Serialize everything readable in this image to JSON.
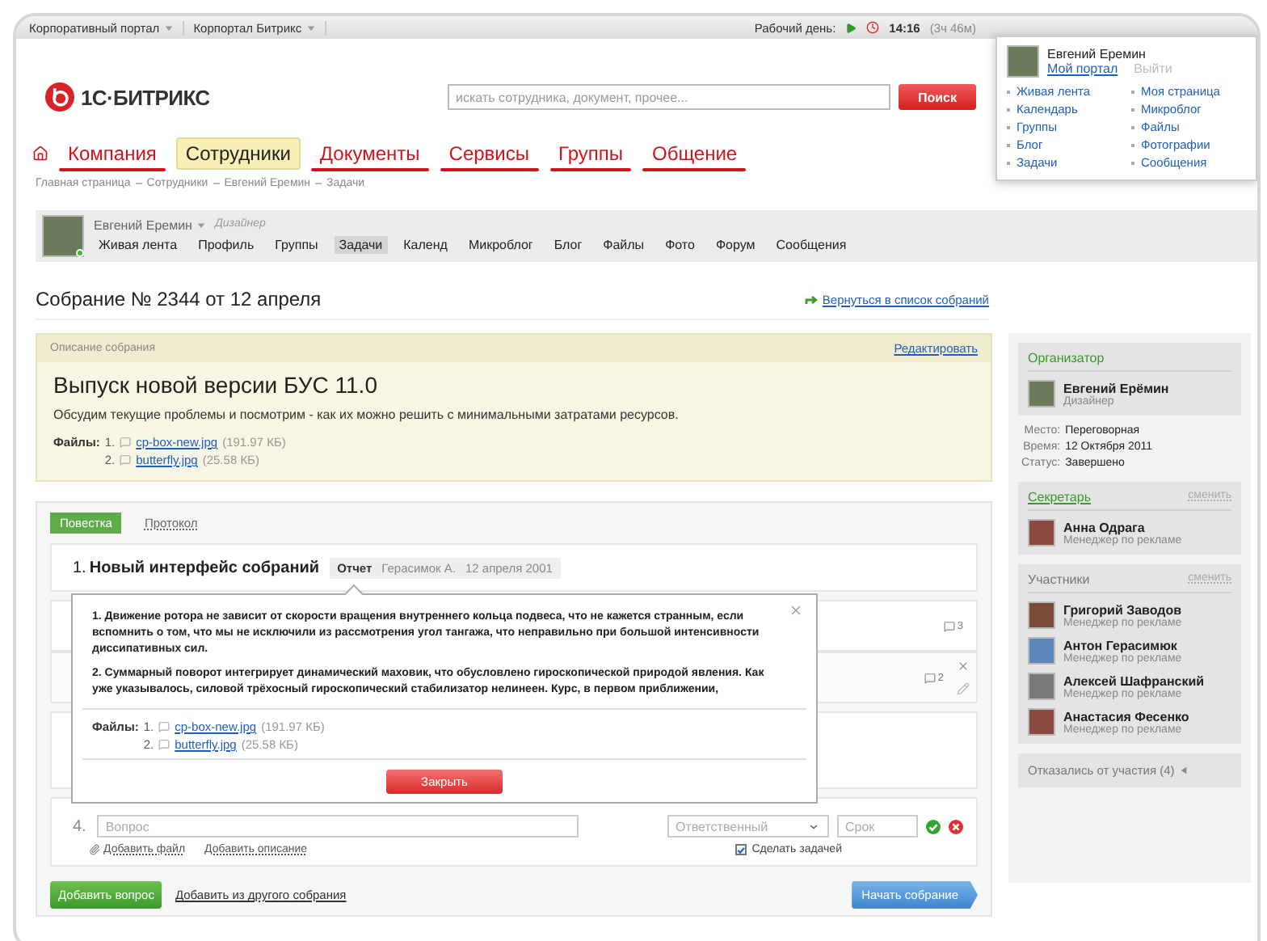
{
  "top_bar": {
    "left_items": [
      "Корпоративный портал",
      "Корпортал Битрикс"
    ],
    "workday_label": "Рабочий день:",
    "time": "14:16",
    "duration": "(3ч 46м)"
  },
  "header": {
    "logo": "1С·БИТРИКС",
    "search": {
      "placeholder": "искать сотрудника, документ, прочее..."
    },
    "search_button": "Поиск"
  },
  "main_nav": [
    {
      "label": "Компания",
      "selected": false
    },
    {
      "label": "Сотрудники",
      "selected": true
    },
    {
      "label": "Документы",
      "selected": false
    },
    {
      "label": "Сервисы",
      "selected": false
    },
    {
      "label": "Группы",
      "selected": false
    },
    {
      "label": "Общение",
      "selected": false
    }
  ],
  "breadcrumbs": [
    "Главная страница",
    "Сотрудники",
    "Евгений Еремин",
    "Задачи"
  ],
  "profile": {
    "name": "Евгений Еремин",
    "role": "Дизайнер",
    "online": true,
    "tabs": [
      {
        "label": "Живая лента",
        "selected": false
      },
      {
        "label": "Профиль",
        "selected": false
      },
      {
        "label": "Группы",
        "selected": false
      },
      {
        "label": "Задачи",
        "selected": true
      },
      {
        "label": "Календ",
        "selected": false
      },
      {
        "label": "Микроблог",
        "selected": false
      },
      {
        "label": "Блог",
        "selected": false
      },
      {
        "label": "Файлы",
        "selected": false
      },
      {
        "label": "Фото",
        "selected": false
      },
      {
        "label": "Форум",
        "selected": false
      },
      {
        "label": "Сообщения",
        "selected": false
      }
    ]
  },
  "page_title": "Собрание № 2344 от 12 апреля",
  "back_link": "Вернуться в список собраний",
  "description": {
    "header": "Описание собрания",
    "edit_link": "Редактировать",
    "title": "Выпуск новой версии БУС 11.0",
    "text": "Обсудим текущие проблемы и посмотрим - как их можно решить с минимальными затратами ресурсов.",
    "files_label": "Файлы:",
    "files": [
      {
        "number": "1.",
        "name": "cp-box-new.jpg",
        "size": "(191.97 КБ)"
      },
      {
        "number": "2.",
        "name": "butterfly.jpg",
        "size": "(25.58 КБ)"
      }
    ]
  },
  "agenda": {
    "tabs": [
      {
        "label": "Повестка",
        "selected": true
      },
      {
        "label": "Протокол",
        "selected": false
      }
    ],
    "items": [
      {
        "kind": "report",
        "number": "1.",
        "title": "Новый интерфейс собраний",
        "report_label": "Отчет",
        "report_author": "Герасимок А.",
        "report_date": "12 апреля 2001"
      },
      {
        "kind": "comments",
        "comments": "3",
        "show_actions": false
      },
      {
        "kind": "comments",
        "comments": "2",
        "show_actions": true
      },
      {
        "kind": "blank"
      }
    ]
  },
  "popup": {
    "paragraphs": [
      "1. Движение ротора не зависит от скорости вращения внутреннего кольца подвеса, что не кажется странным, если вспомнить о том, что мы не исключили из рассмотрения угол тангажа, что неправильно при большой интенсивности диссипативных сил.",
      "2. Суммарный поворот интегрирует динамический маховик, что обусловлено гироскопической природой явления. Как уже указывалось, силовой трёхосный гироскопический стабилизатор нелинеен. Курс, в первом приближении,"
    ],
    "files_label": "Файлы:",
    "files": [
      {
        "number": "1.",
        "name": "cp-box-new.jpg",
        "size": "(191.97 КБ)"
      },
      {
        "number": "2.",
        "name": "butterfly.jpg",
        "size": "(25.58 КБ)"
      }
    ],
    "close_button": "Закрыть"
  },
  "new_item": {
    "number": "4.",
    "question": {
      "placeholder": "Вопрос"
    },
    "responsible": {
      "placeholder": "Ответственный"
    },
    "deadline": {
      "placeholder": "Срок"
    },
    "add_file": "Добавить файл",
    "add_description": "Добавить описание",
    "make_task": {
      "label": "Сделать задачей",
      "checked": true
    }
  },
  "actions": {
    "add_question": "Добавить вопрос",
    "add_from_other": "Добавить из другого собрания",
    "start": "Начать собрание"
  },
  "sidebar": {
    "organizer": {
      "title": "Организатор",
      "name": "Евгений Ерёмин",
      "role": "Дизайнер"
    },
    "details": [
      {
        "label": "Место:",
        "value": "Переговорная"
      },
      {
        "label": "Время:",
        "value": "12 Октября 2011"
      },
      {
        "label": "Статус:",
        "value": "Завершено"
      }
    ],
    "secretary": {
      "title": "Секретарь",
      "change": "сменить",
      "name": "Анна Одрага",
      "role": "Менеджер по рекламе"
    },
    "participants": {
      "title": "Участники",
      "change": "сменить",
      "people": [
        {
          "name": "Григорий Заводов",
          "role": "Менеджер по рекламе"
        },
        {
          "name": "Антон Герасимюк",
          "role": "Менеджер по рекламе"
        },
        {
          "name": "Алексей Шафранский",
          "role": "Менеджер по рекламе"
        },
        {
          "name": "Анастасия Фесенко",
          "role": "Менеджер по рекламе"
        }
      ]
    },
    "declined": "Отказались от участия (4)"
  },
  "user_menu": {
    "name": "Евгений Еремин",
    "portal_link": "Мой портал",
    "logout": "Выйти",
    "links": [
      "Живая лента",
      "Моя страница",
      "Календарь",
      "Микроблог",
      "Группы",
      "Файлы",
      "Блог",
      "Фотографии",
      "Задачи",
      "Сообщения"
    ]
  }
}
